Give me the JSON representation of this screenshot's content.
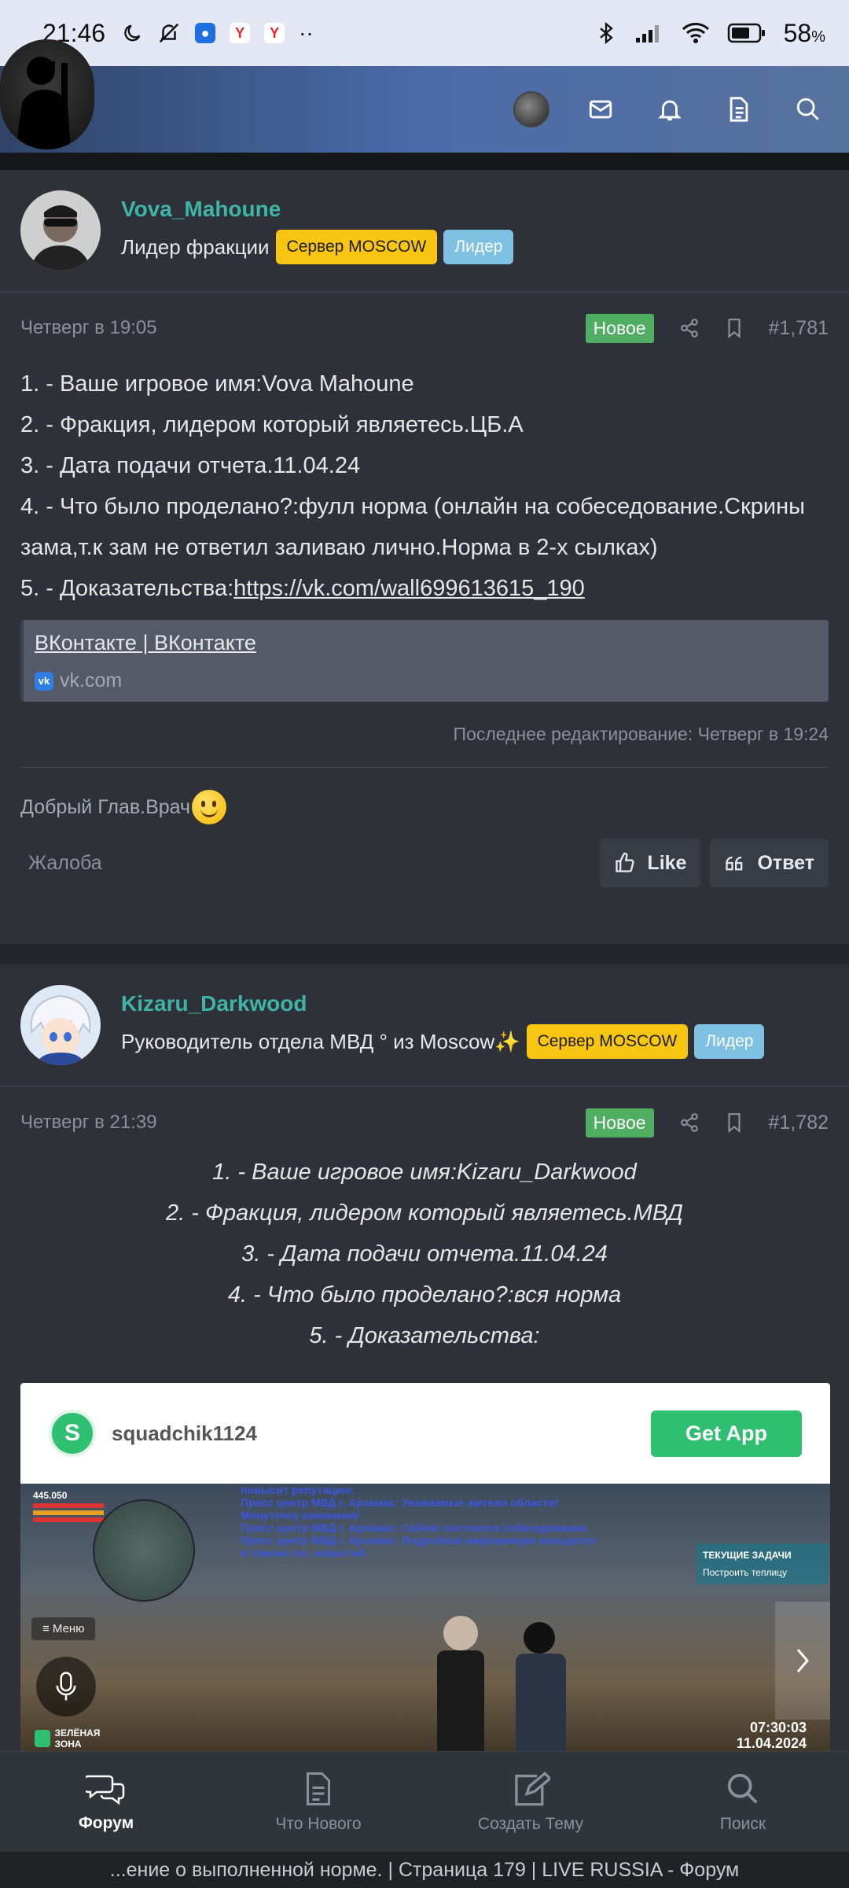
{
  "status_bar": {
    "time": "21:46",
    "battery": "58"
  },
  "post1": {
    "username": "Vova_Mahoune",
    "user_title": "Лидер фракции",
    "badge_server": "Сервер MOSCOW",
    "badge_role": "Лидер",
    "date": "Четверг в 19:05",
    "new_badge": "Новое",
    "post_number": "#1,781",
    "lines": [
      "1. - Ваше игровое имя:Vova Mahoune",
      "2. - Фракция, лидером который являетесь.ЦБ.А",
      "3. - Дата подачи отчета.11.04.24",
      "4. - Что было проделано?:фулл норма (онлайн на собеседование.Скрины зама,т.к зам не ответил заливаю лично.Норма в 2-х сылках)"
    ],
    "line5_prefix": "5. - Доказательства:",
    "line5_link": "https://vk.com/wall699613615_190",
    "link_card_title": "ВКонтакте | ВКонтакте",
    "link_card_site": "vk.com",
    "link_card_site_icon": "vk",
    "edit_note": "Последнее редактирование: Четверг в 19:24",
    "signature": "Добрый Глав.Врач",
    "report_label": "Жалоба",
    "like_label": "Like",
    "reply_label": "Ответ"
  },
  "post2": {
    "username": "Kizaru_Darkwood",
    "user_title": "Руководитель отдела МВД ° из Moscow✨",
    "badge_server": "Сервер MOSCOW",
    "badge_role": "Лидер",
    "date": "Четверг в 21:39",
    "new_badge": "Новое",
    "post_number": "#1,782",
    "lines": [
      "1. - Ваше игровое имя:Kizaru_Darkwood",
      "2. - Фракция, лидером который являетесь.МВД",
      "3. - Дата подачи отчета.11.04.24",
      "4. - Что было проделано?:вся норма",
      "5. - Доказательства:"
    ],
    "embed": {
      "logo_letter": "S",
      "account": "squadchik1124",
      "get_app": "Get App",
      "hud_money": "445.050",
      "hud_menu": "Меню",
      "hud_zone": "ЗЕЛЁНАЯ ЗОНА",
      "hud_tasks": "ТЕКУЩИЕ ЗАДАЧИ",
      "hud_task_item": "Построить теплицу",
      "chat_lines": [
        "повысит репутацию.",
        "Пресс центр МВД г. Арзамас: Уважаемые жители области!",
        "Минуточку внимания!",
        "Пресс центр МВД г. Арзамас: Сейчас состоится собеседование.",
        "Пресс центр МВД г. Арзамас: Подробная информация находится",
        "в списке гос. новостей."
      ],
      "clock_time": "07:30:03",
      "clock_date": "11.04.2024"
    }
  },
  "bottom_nav": [
    {
      "label": "Форум",
      "icon": "chat-bubbles-icon",
      "active": true
    },
    {
      "label": "Что Нового",
      "icon": "document-icon",
      "active": false
    },
    {
      "label": "Создать Тему",
      "icon": "edit-icon",
      "active": false
    },
    {
      "label": "Поиск",
      "icon": "search-icon",
      "active": false
    }
  ],
  "page_url_title": "...ение о выполненной норме. | Страница 179 | LIVE RUSSIA - Форум",
  "colors": {
    "accent_teal": "#3fb5a7",
    "badge_yellow": "#f7c512",
    "badge_blue": "#7fc1e2",
    "new_green": "#4fae62",
    "tiktok_green": "#2fbf71"
  }
}
